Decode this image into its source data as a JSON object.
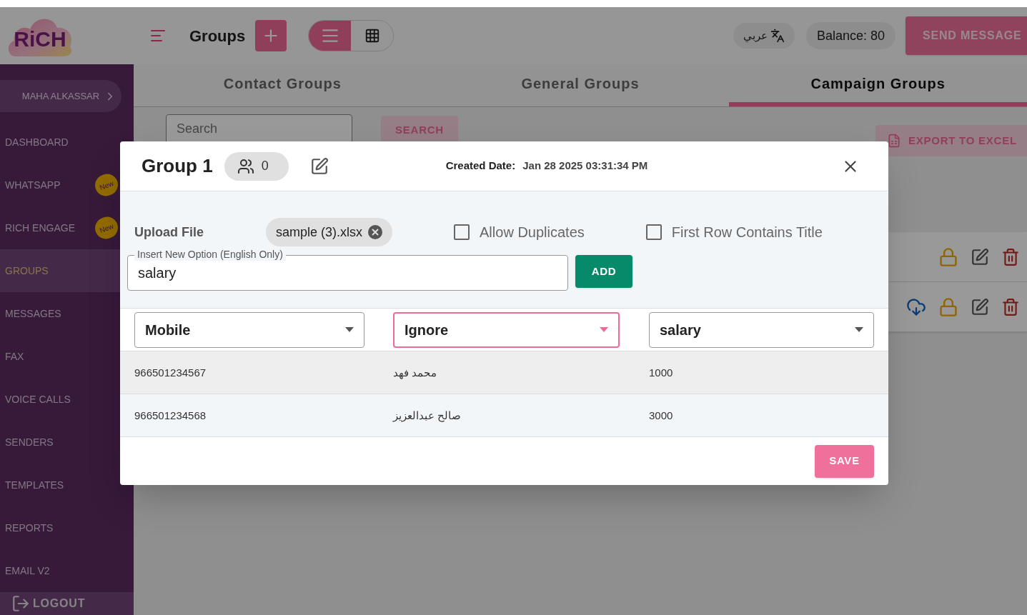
{
  "logo": {
    "text": "RiCH"
  },
  "header": {
    "title": "Groups",
    "language": "عربي",
    "balance": "Balance: 80",
    "send_button": "SEND MESSAGE",
    "view_toggle": [
      {
        "kind": "list",
        "selected": true
      },
      {
        "kind": "grid",
        "selected": false
      }
    ]
  },
  "sidebar": {
    "user": "MAHA ALKASSAR",
    "items": [
      {
        "label": "DASHBOARD",
        "selected": false
      },
      {
        "label": "WHATSAPP",
        "selected": false,
        "badge": "New"
      },
      {
        "label": "RICH ENGAGE",
        "selected": false,
        "badge": "New"
      },
      {
        "label": "GROUPS",
        "selected": true
      },
      {
        "label": "MESSAGES",
        "selected": false
      },
      {
        "label": "FAX",
        "selected": false
      },
      {
        "label": "VOICE CALLS",
        "selected": false
      },
      {
        "label": "SENDERS",
        "selected": false
      },
      {
        "label": "TEMPLATES",
        "selected": false
      },
      {
        "label": "REPORTS",
        "selected": false
      },
      {
        "label": "EMAIL V2",
        "selected": false
      }
    ],
    "logout": "LOGOUT"
  },
  "tabs": [
    {
      "label": "Contact Groups",
      "selected": false
    },
    {
      "label": "General Groups",
      "selected": false
    },
    {
      "label": "Campaign Groups",
      "selected": true
    }
  ],
  "search": {
    "placeholder": "Search",
    "button": "SEARCH"
  },
  "export_button": "EXPORT TO EXCEL",
  "group_rows": [
    {
      "downloadable": false
    },
    {
      "downloadable": true
    }
  ],
  "dialog": {
    "title": "Group 1",
    "member_count": "0",
    "created_label": "Created Date:",
    "created_date": "Jan 28 2025 03:31:34 PM",
    "upload_label": "Upload File",
    "file_chip": "sample (3).xlsx",
    "checkboxes": [
      {
        "label": "Allow Duplicates",
        "checked": false
      },
      {
        "label": "First Row Contains Title",
        "checked": false
      }
    ],
    "option_field": {
      "label": "Insert New Option (English Only)",
      "value": "salary"
    },
    "add_button": "ADD",
    "columns": [
      {
        "value": "Mobile",
        "focused": false
      },
      {
        "value": "Ignore",
        "focused": true
      },
      {
        "value": "salary",
        "focused": false
      }
    ],
    "rows": [
      {
        "cells": [
          "966501234567",
          "محمد فهد",
          "1000"
        ]
      },
      {
        "cells": [
          "966501234568",
          "صالح عبدالعزيز",
          "3000"
        ]
      }
    ],
    "save_button": "SAVE"
  }
}
